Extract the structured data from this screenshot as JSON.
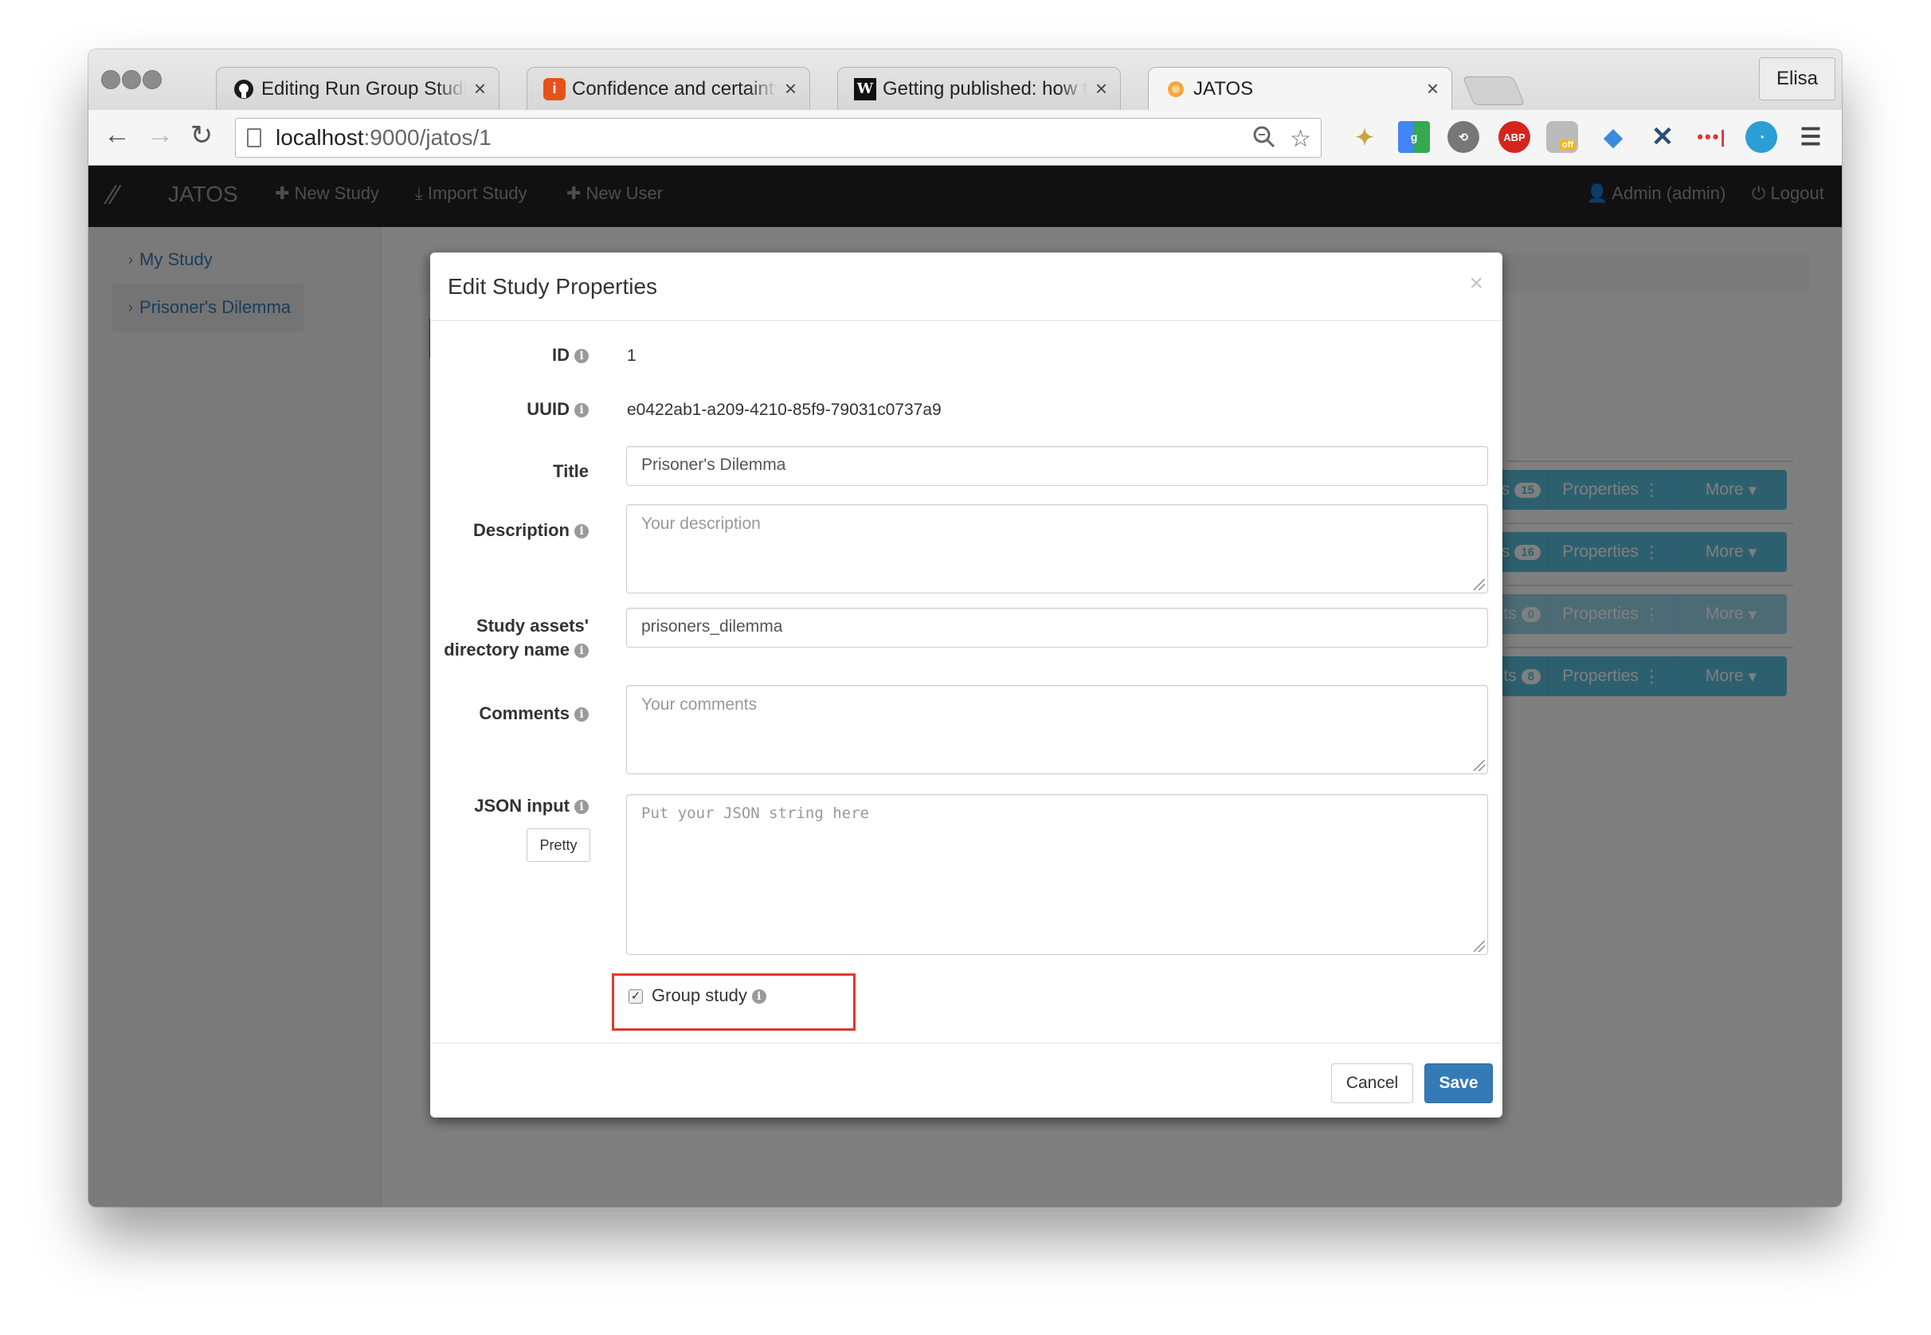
{
  "browser": {
    "tabs": [
      {
        "icon": "github-icon",
        "title": "Editing Run Group Studies · JATOS",
        "active": false
      },
      {
        "icon": "orcid-icon",
        "title": "Confidence and certainty: distinct",
        "active": false
      },
      {
        "icon": "wiki-icon",
        "title": "Getting published: how to write",
        "active": false
      },
      {
        "icon": "jatos-favicon",
        "title": "JATOS",
        "active": true
      }
    ],
    "profile_name": "Elisa",
    "url_host": "localhost",
    "url_path": ":9000/jatos/1",
    "extensions": [
      "wand-icon",
      "google-icon",
      "share-icon",
      "abp-icon",
      "incognito-icon",
      "diamond-icon",
      "cross-icon",
      "dots-icon",
      "clock-icon",
      "menu-icon"
    ],
    "abp_label": "ABP",
    "off_label": "off"
  },
  "jatos_nav": {
    "brand": "JATOS",
    "new_study": "New Study",
    "import_study": "Import Study",
    "new_user": "New User",
    "user": "Admin (admin)",
    "logout": "Logout"
  },
  "sidebar": {
    "items": [
      {
        "label": "My Study"
      },
      {
        "label": "Prisoner's Dilemma"
      }
    ]
  },
  "background_rows": [
    {
      "count": "15",
      "properties": "Properties",
      "more": "More",
      "disabled": false
    },
    {
      "count": "16",
      "properties": "Properties",
      "more": "More",
      "disabled": false
    },
    {
      "count": "0",
      "properties": "Properties",
      "more": "More",
      "disabled": true
    },
    {
      "count": "8",
      "properties": "Properties",
      "more": "More",
      "disabled": false
    }
  ],
  "modal": {
    "title": "Edit Study Properties",
    "close": "×",
    "id_label": "ID",
    "id_value": "1",
    "uuid_label": "UUID",
    "uuid_value": "e0422ab1-a209-4210-85f9-79031c0737a9",
    "title_label": "Title",
    "title_value": "Prisoner's Dilemma",
    "description_label": "Description",
    "description_placeholder": "Your description",
    "assets_label_1": "Study assets'",
    "assets_label_2": "directory name",
    "assets_value": "prisoners_dilemma",
    "comments_label": "Comments",
    "comments_placeholder": "Your comments",
    "json_label": "JSON input",
    "json_placeholder": "Put your JSON string here",
    "pretty_button": "Pretty",
    "group_study_label": "Group study",
    "group_study_checked": true,
    "cancel": "Cancel",
    "save": "Save"
  },
  "colors": {
    "primary": "#337ab7",
    "info": "#5bc0de",
    "highlight": "#e0392b",
    "navbar": "#222222"
  }
}
